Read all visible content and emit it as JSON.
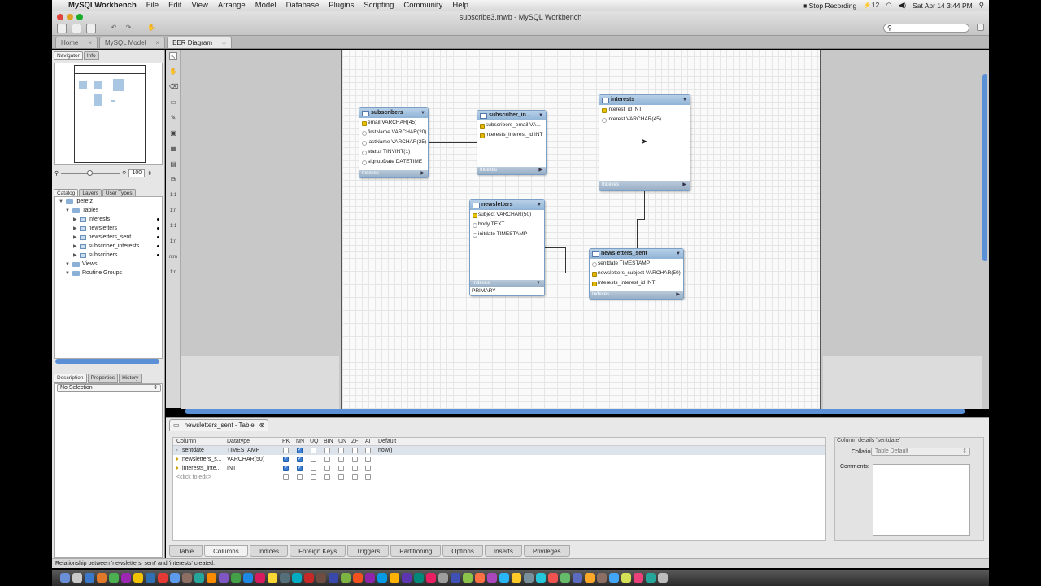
{
  "menubar": {
    "app_name": "MySQLWorkbench",
    "items": [
      "File",
      "Edit",
      "View",
      "Arrange",
      "Model",
      "Database",
      "Plugins",
      "Scripting",
      "Community",
      "Help"
    ],
    "stop_recording": "Stop Recording",
    "clock": "Sat Apr 14  3:44 PM",
    "battery": "12"
  },
  "window": {
    "title": "subscribe3.mwb - MySQL Workbench"
  },
  "doc_tabs": [
    "Home",
    "MySQL Model",
    "EER Diagram"
  ],
  "navigator": {
    "tabs": [
      "Navigator",
      "Info"
    ],
    "zoom": "100"
  },
  "catalog": {
    "tabs": [
      "Catalog",
      "Layers",
      "User Types"
    ],
    "schema": "jperetz",
    "tables_folder": "Tables",
    "tables": [
      "interests",
      "newsletters",
      "newsletters_sent",
      "subscriber_interests",
      "subscribers"
    ],
    "views": "Views",
    "routine_groups": "Routine Groups"
  },
  "description": {
    "tabs": [
      "Description",
      "Properties",
      "History"
    ],
    "selection": "No Selection"
  },
  "tables": {
    "subscribers": {
      "name": "subscribers",
      "cols": [
        "email VARCHAR(45)",
        "firstName VARCHAR(20)",
        "lastName VARCHAR(25)",
        "status TINYINT(1)",
        "signupDate DATETIME"
      ],
      "indexes": "Indexes"
    },
    "subscriber_interests": {
      "name": "subscriber_in...",
      "cols": [
        "subscribers_email VA...",
        "interests_interest_id INT"
      ],
      "indexes": "Indexes"
    },
    "interests": {
      "name": "interests",
      "cols": [
        "interest_id INT",
        "interest VARCHAR(45)"
      ],
      "indexes": "Indexes"
    },
    "newsletters": {
      "name": "newsletters",
      "cols": [
        "subject VARCHAR(50)",
        "body TEXT",
        "initdate TIMESTAMP"
      ],
      "indexes": "Indexes",
      "index_item": "PRIMARY"
    },
    "newsletters_sent": {
      "name": "newsletters_sent",
      "cols": [
        "sentdate TIMESTAMP",
        "newsletters_subject VARCHAR(50)",
        "interests_interest_id INT"
      ],
      "indexes": "Indexes"
    }
  },
  "editor": {
    "tab_title": "newsletters_sent - Table",
    "headers": [
      "Column",
      "Datatype",
      "PK",
      "NN",
      "UQ",
      "BIN",
      "UN",
      "ZF",
      "AI",
      "Default"
    ],
    "rows": [
      {
        "col": "sentdate",
        "type": "TIMESTAMP",
        "pk": false,
        "nn": true,
        "def": "now()"
      },
      {
        "col": "newsletters_s...",
        "type": "VARCHAR(50)",
        "pk": true,
        "nn": true,
        "def": ""
      },
      {
        "col": "interests_inte...",
        "type": "INT",
        "pk": true,
        "nn": true,
        "def": ""
      }
    ],
    "click_to_edit": "<click to edit>",
    "details_title": "Column details 'sentdate'",
    "collation_label": "Collation:",
    "collation_value": "Table Default",
    "comments_label": "Comments:",
    "bottom_tabs": [
      "Table",
      "Columns",
      "Indices",
      "Foreign Keys",
      "Triggers",
      "Partitioning",
      "Options",
      "Inserts",
      "Privileges"
    ]
  },
  "status": "Relationship between 'newsletters_sent' and 'interests' created."
}
